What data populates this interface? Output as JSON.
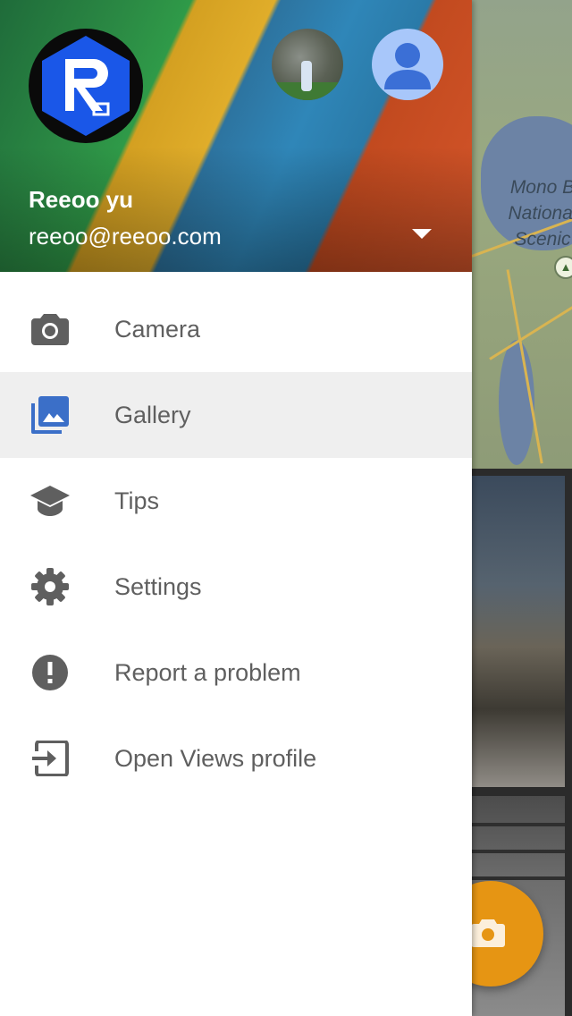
{
  "account": {
    "name": "Reeoo yu",
    "email": "reeoo@reeoo.com"
  },
  "menu": {
    "items": [
      {
        "label": "Camera",
        "icon": "camera-icon"
      },
      {
        "label": "Gallery",
        "icon": "gallery-icon",
        "selected": true
      },
      {
        "label": "Tips",
        "icon": "graduation-cap-icon"
      },
      {
        "label": "Settings",
        "icon": "gear-icon"
      },
      {
        "label": "Report a problem",
        "icon": "alert-icon"
      },
      {
        "label": "Open Views profile",
        "icon": "open-profile-icon"
      }
    ]
  },
  "map": {
    "label_line1": "Mono B",
    "label_line2": "National",
    "label_line3": "Scenic"
  },
  "colors": {
    "accent_fab": "#e69513",
    "active_item_bg": "#efefef",
    "icon_grey": "#5f5f5f",
    "gallery_blue": "#3b6fc8",
    "avatar_blue": "#3b6fd6"
  }
}
